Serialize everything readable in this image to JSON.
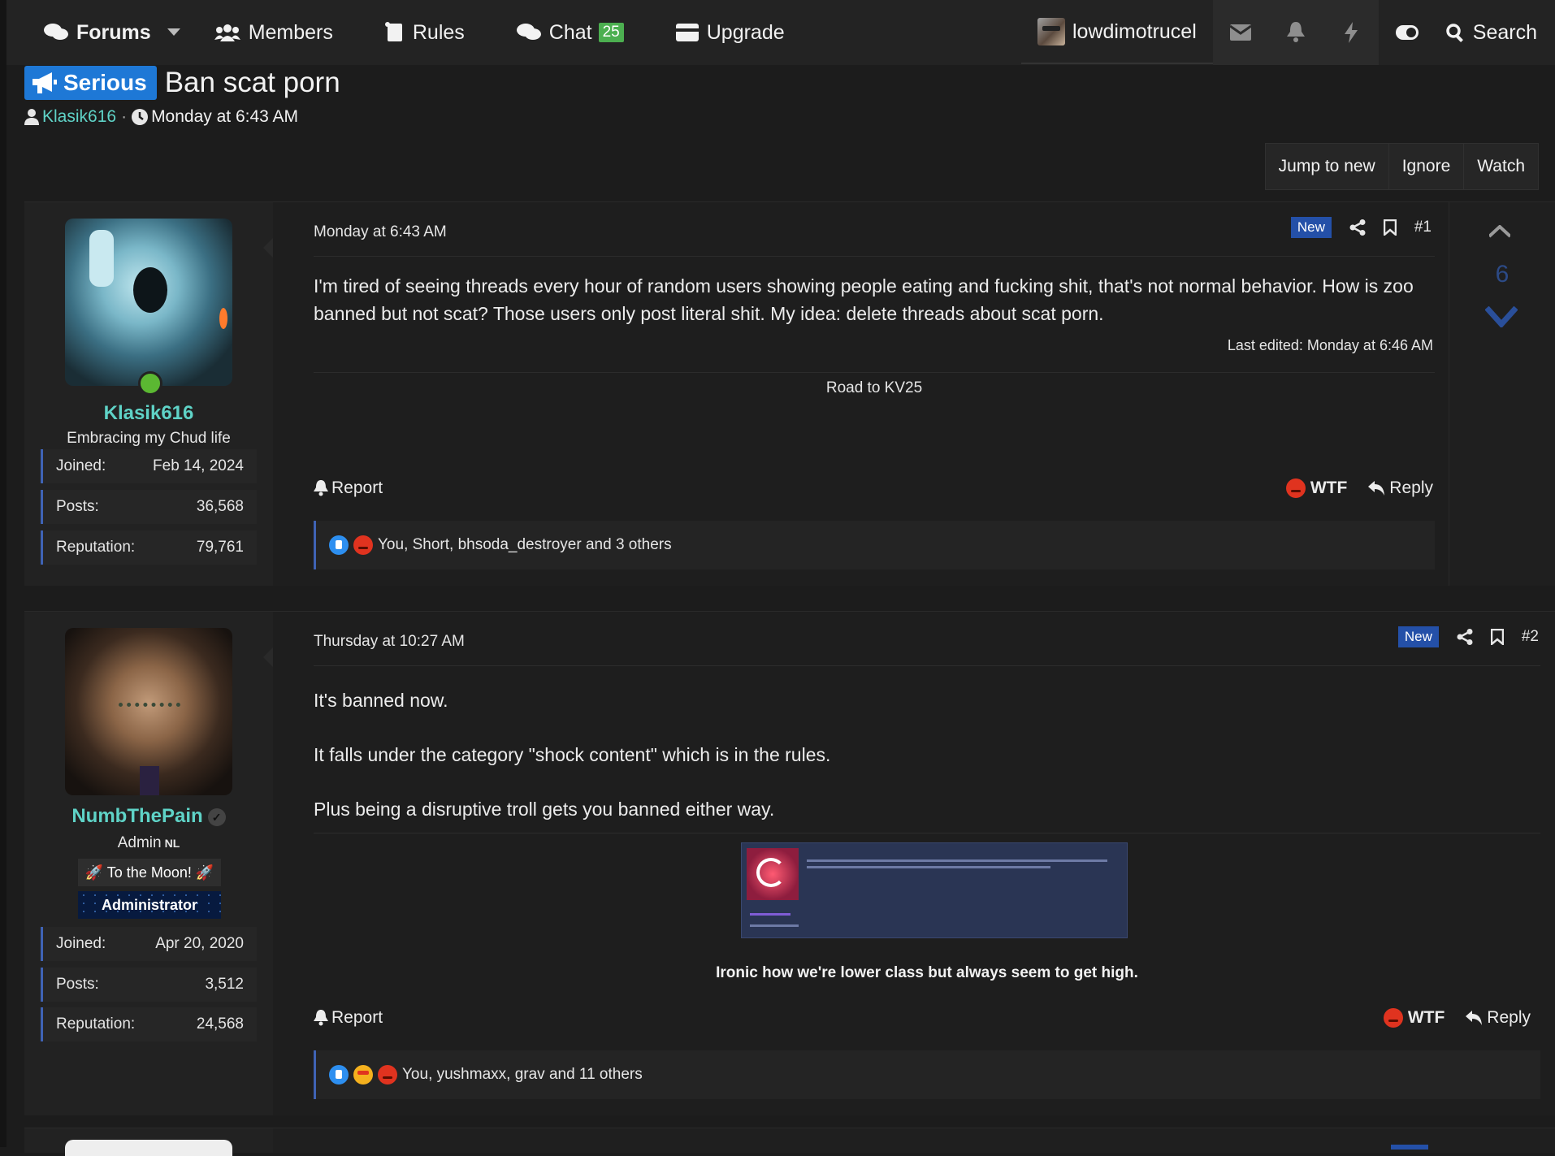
{
  "nav": {
    "forums": "Forums",
    "members": "Members",
    "rules": "Rules",
    "chat": "Chat",
    "chat_badge": "25",
    "upgrade": "Upgrade",
    "username": "lowdimotrucel",
    "search": "Search"
  },
  "thread": {
    "prefix": "Serious",
    "title": "Ban scat porn",
    "author": "Klasik616",
    "separator": "·",
    "date": "Monday at 6:43 AM",
    "buttons": [
      "Jump to new",
      "Ignore",
      "Watch"
    ]
  },
  "posts": [
    {
      "username": "Klasik616",
      "user_title": "Embracing my Chud life",
      "stats": [
        {
          "label": "Joined:",
          "value": "Feb 14, 2024"
        },
        {
          "label": "Posts:",
          "value": "36,568"
        },
        {
          "label": "Reputation:",
          "value": "79,761"
        }
      ],
      "date": "Monday at 6:43 AM",
      "new_label": "New",
      "number": "#1",
      "body": [
        "I'm tired of seeing threads every hour of random users showing people eating and fucking shit, that's not normal behavior. How is zoo banned but not scat? Those users only post literal shit. My idea: delete threads about scat porn."
      ],
      "last_edited": "Last edited: Monday at 6:46 AM",
      "signature": "Road to KV25",
      "report": "Report",
      "wtf": "WTF",
      "reply": "Reply",
      "reactions": "You, Short, bhsoda_destroyer and 3 others",
      "vote_count": "6"
    },
    {
      "username": "NumbThePain",
      "user_title": "Admin",
      "user_flag": "NL",
      "banner_1": "🚀 To the Moon! 🚀",
      "banner_2": "Administrator",
      "stats": [
        {
          "label": "Joined:",
          "value": "Apr 20, 2020"
        },
        {
          "label": "Posts:",
          "value": "3,512"
        },
        {
          "label": "Reputation:",
          "value": "24,568"
        }
      ],
      "date": "Thursday at 10:27 AM",
      "new_label": "New",
      "number": "#2",
      "body": [
        "It's banned now.",
        "It falls under the category \"shock content\" which is in the rules.",
        "Plus being a disruptive troll gets you banned either way."
      ],
      "signature_quote": "Ironic how we're lower class but always seem to get high.",
      "report": "Report",
      "wtf": "WTF",
      "reply": "Reply",
      "reactions": "You, yushmaxx, grav and 11 others"
    }
  ],
  "colors": {
    "background": "#1c1c1c",
    "accent_blue": "#1e78d6",
    "username_teal": "#5fd3c7",
    "new_badge": "#2450a8",
    "chat_badge": "#4caf50"
  },
  "icons": [
    "forums-icon",
    "members-icon",
    "rules-icon",
    "chat-icon",
    "upgrade-icon",
    "mail-icon",
    "bell-icon",
    "bolt-icon",
    "toggle-icon",
    "search-icon",
    "megaphone-icon",
    "user-icon",
    "clock-icon",
    "share-icon",
    "bookmark-icon",
    "report-bell-icon",
    "reply-icon",
    "chevron-up-icon",
    "chevron-down-icon"
  ]
}
